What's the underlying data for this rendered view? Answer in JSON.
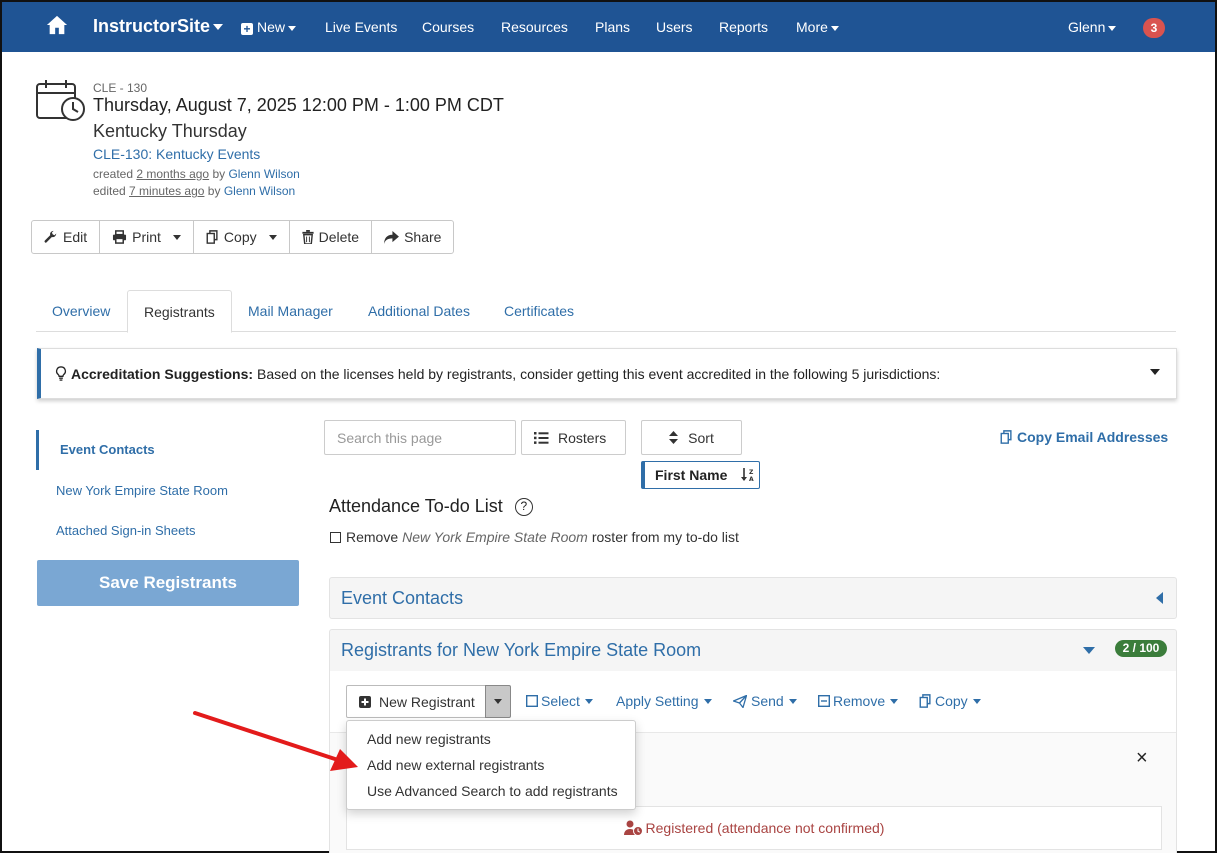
{
  "nav": {
    "brand": "InstructorSite",
    "new": "New",
    "items": [
      "Live Events",
      "Courses",
      "Resources",
      "Plans",
      "Users",
      "Reports"
    ],
    "more": "More",
    "user": "Glenn",
    "notifications": "3"
  },
  "event": {
    "code": "CLE - 130",
    "datetime": "Thursday, August 7, 2025 12:00 PM - 1:00 PM CDT",
    "name": "Kentucky Thursday",
    "course_link": "CLE-130: Kentucky Events",
    "created_prefix": "created",
    "created_when": "2 months ago",
    "by": "by",
    "created_by": "Glenn Wilson",
    "edited_prefix": "edited",
    "edited_when": "7 minutes ago",
    "edited_by": "Glenn Wilson"
  },
  "actions": {
    "edit": "Edit",
    "print": "Print",
    "copy": "Copy",
    "delete": "Delete",
    "share": "Share"
  },
  "tabs": [
    "Overview",
    "Registrants",
    "Mail Manager",
    "Additional Dates",
    "Certificates"
  ],
  "alert": {
    "label": "Accreditation Suggestions:",
    "text": "Based on the licenses held by registrants, consider getting this event accredited in the following 5 jurisdictions:"
  },
  "sidebar": {
    "items": [
      "Event Contacts",
      "New York Empire State Room",
      "Attached Sign-in Sheets"
    ],
    "save": "Save Registrants"
  },
  "search": {
    "placeholder": "Search this page"
  },
  "rosters": "Rosters",
  "sort": "Sort",
  "sort_field": "First Name",
  "copy_email": "Copy Email Addresses",
  "todo": {
    "title": "Attendance To-do List",
    "help": "?",
    "remove": "Remove",
    "room": "New York Empire State Room",
    "suffix": "roster from my to-do list"
  },
  "panels": {
    "contacts": "Event Contacts",
    "registrants": "Registrants for New York Empire State Room",
    "count": "2 / 100"
  },
  "reg_toolbar": {
    "new_registrant": "New Registrant",
    "select": "Select",
    "apply_setting": "Apply Setting",
    "send": "Send",
    "remove": "Remove",
    "copy": "Copy"
  },
  "dropdown": {
    "options": [
      "Add new registrants",
      "Add new external registrants",
      "Use Advanced Search to add registrants"
    ]
  },
  "close": "×",
  "status": "Registered (attendance not confirmed)",
  "colors": {
    "nav": "#1f5494",
    "link": "#2f6ea8",
    "badge": "#d9534f",
    "count": "#3b7d3b",
    "arrow": "#e31b1b"
  }
}
